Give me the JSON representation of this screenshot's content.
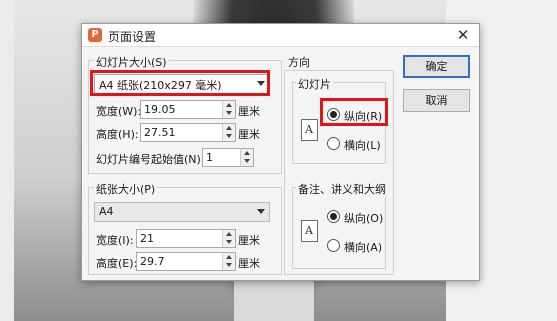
{
  "dialog": {
    "title": "页面设置",
    "close_glyph": "✕",
    "slide_size": {
      "group_title": "幻灯片大小(S)",
      "selected": "A4 纸张(210x297 毫米)",
      "width_label": "宽度(W):",
      "width_value": "19.05",
      "width_unit": "厘米",
      "height_label": "高度(H):",
      "height_value": "27.51",
      "height_unit": "厘米",
      "start_label": "幻灯片编号起始值(N):",
      "start_value": "1"
    },
    "paper_size": {
      "group_title": "纸张大小(P)",
      "selected": "A4",
      "width_label": "宽度(I):",
      "width_value": "21",
      "width_unit": "厘米",
      "height_label": "高度(E):",
      "height_value": "29.7",
      "height_unit": "厘米"
    },
    "orientation": {
      "title": "方向",
      "slides": {
        "group_title": "幻灯片",
        "icon_letter": "A",
        "portrait": "纵向(R)",
        "landscape": "横向(L)"
      },
      "notes": {
        "group_title": "备注、讲义和大纲",
        "icon_letter": "A",
        "portrait": "纵向(O)",
        "landscape": "横向(A)"
      }
    },
    "buttons": {
      "ok": "确定",
      "cancel": "取消"
    }
  }
}
